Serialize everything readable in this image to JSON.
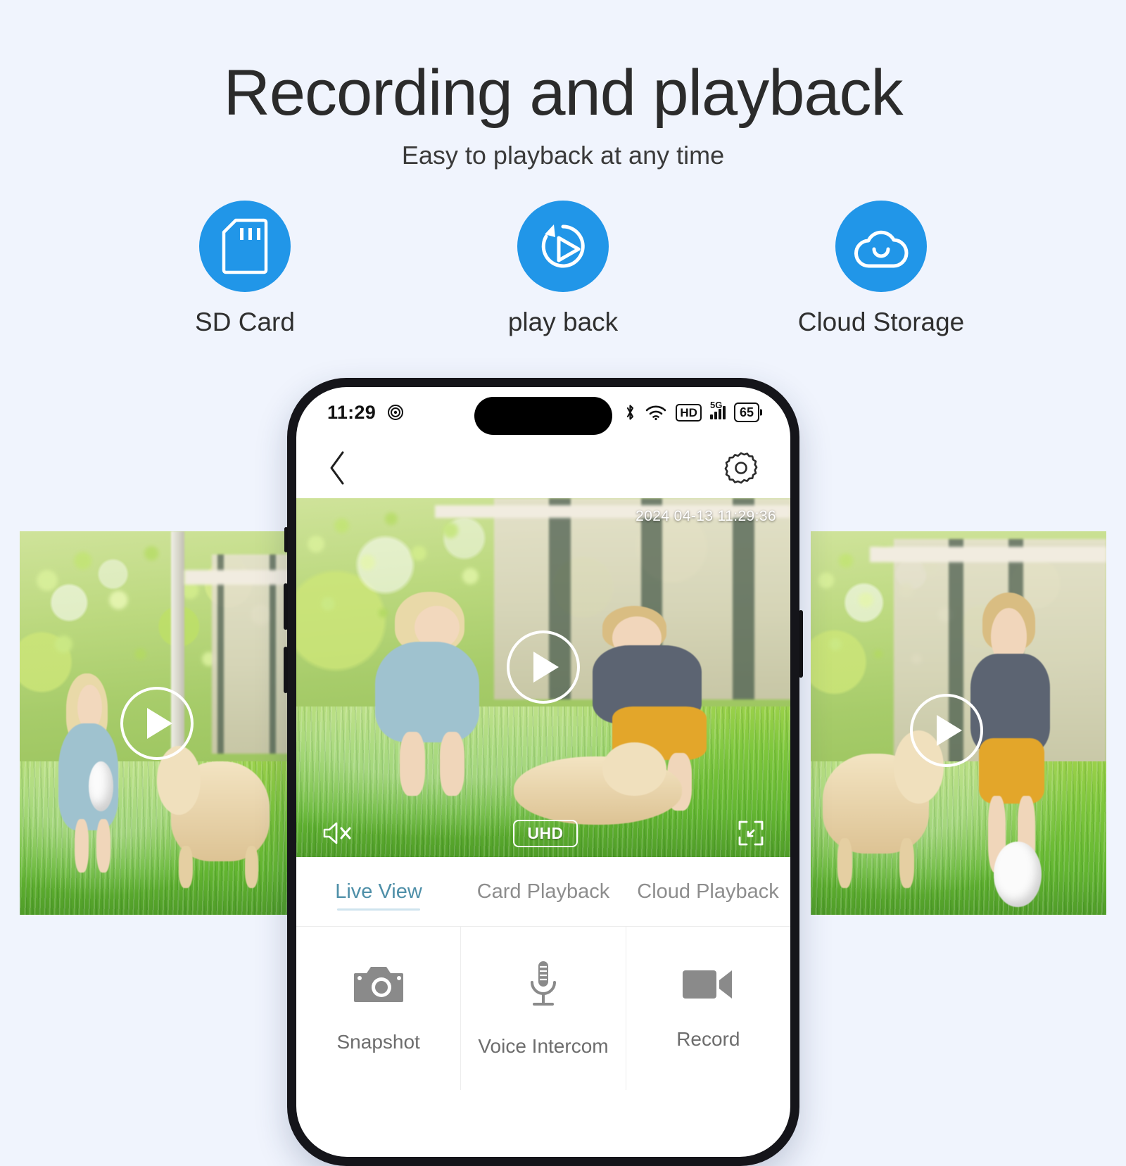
{
  "header": {
    "title": "Recording and playback",
    "subtitle": "Easy to playback at any time"
  },
  "features": [
    {
      "label": "SD Card",
      "icon": "sd-card-icon"
    },
    {
      "label": "play back",
      "icon": "playback-icon"
    },
    {
      "label": "Cloud Storage",
      "icon": "cloud-icon"
    }
  ],
  "colors": {
    "page_background": "#f0f4fd",
    "accent_blue": "#2196e8",
    "active_tab": "#4e8fa8",
    "inactive_tab": "#8d8d8d",
    "action_icon": "#8a8a8a"
  },
  "phone": {
    "status_bar": {
      "time": "11:29",
      "icons": [
        "location-target-icon",
        "bluetooth-icon",
        "wifi-icon",
        "hd-icon",
        "5g-signal-icon",
        "battery-icon"
      ],
      "hd_label": "HD",
      "network_label": "5G",
      "battery_level": "65"
    },
    "nav_bar": {
      "back_icon": "back-chevron-icon",
      "settings_icon": "gear-icon"
    },
    "video": {
      "timestamp": "2024 04-13 11:29:36",
      "quality_badge": "UHD",
      "mute_icon": "speaker-muted-icon",
      "fullscreen_icon": "fullscreen-icon",
      "play_icon": "play-icon"
    },
    "tabs": [
      {
        "label": "Live View",
        "active": true
      },
      {
        "label": "Card Playback",
        "active": false
      },
      {
        "label": "Cloud Playback",
        "active": false
      }
    ],
    "actions": [
      {
        "label": "Snapshot",
        "icon": "camera-icon"
      },
      {
        "label": "Voice Intercom",
        "icon": "microphone-icon"
      },
      {
        "label": "Record",
        "icon": "video-camera-icon"
      }
    ]
  },
  "thumbnails": [
    {
      "play_icon": "play-icon"
    },
    {
      "play_icon": "play-icon"
    }
  ]
}
